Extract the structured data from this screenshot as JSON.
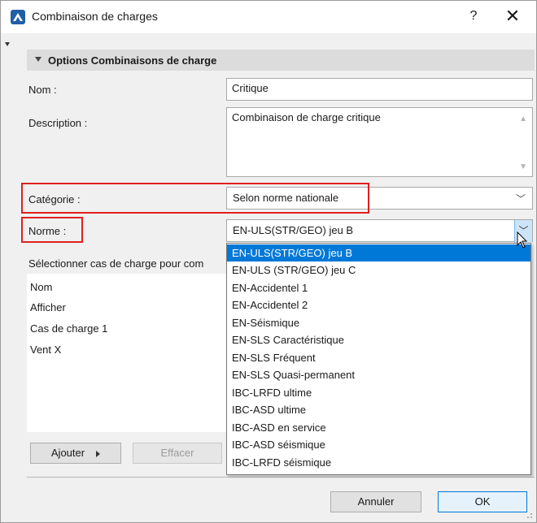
{
  "window": {
    "title": "Combinaison de charges",
    "help_label": "?",
    "close_label": "✕"
  },
  "section": {
    "title": "Options Combinaisons de charge"
  },
  "form": {
    "name_label": "Nom :",
    "name_value": "Critique",
    "description_label": "Description :",
    "description_value": "Combinaison de charge critique",
    "category_label": "Catégorie :",
    "category_value": "Selon norme nationale",
    "norm_label": "Norme :",
    "norm_value": "EN-ULS(STR/GEO) jeu B"
  },
  "load_cases": {
    "heading": "Sélectionner cas de charge pour com",
    "items": [
      "Nom",
      "Afficher",
      "Cas de charge 1",
      "Vent X"
    ]
  },
  "norm_dropdown": {
    "selected_index": 0,
    "options": [
      "EN-ULS(STR/GEO) jeu B",
      "EN-ULS (STR/GEO) jeu C",
      "EN-Accidentel 1",
      "EN-Accidentel 2",
      "EN-Séismique",
      "EN-SLS Caractéristique",
      "EN-SLS Fréquent",
      "EN-SLS Quasi-permanent",
      "IBC-LRFD ultime",
      "IBC-ASD ultime",
      "IBC-ASD en service",
      "IBC-ASD séismique",
      "IBC-LRFD séismique"
    ]
  },
  "buttons": {
    "add_label": "Ajouter",
    "delete_label": "Effacer",
    "cancel_label": "Annuler",
    "ok_label": "OK"
  },
  "colors": {
    "highlight": "#e02020",
    "selection": "#0078d7",
    "app_icon": "#1f5fa8"
  },
  "icons": {
    "app": "archicad-app-icon",
    "collapse": "triangle-down-icon",
    "dropdown": "chevron-down-icon",
    "cursor": "mouse-pointer-icon"
  }
}
